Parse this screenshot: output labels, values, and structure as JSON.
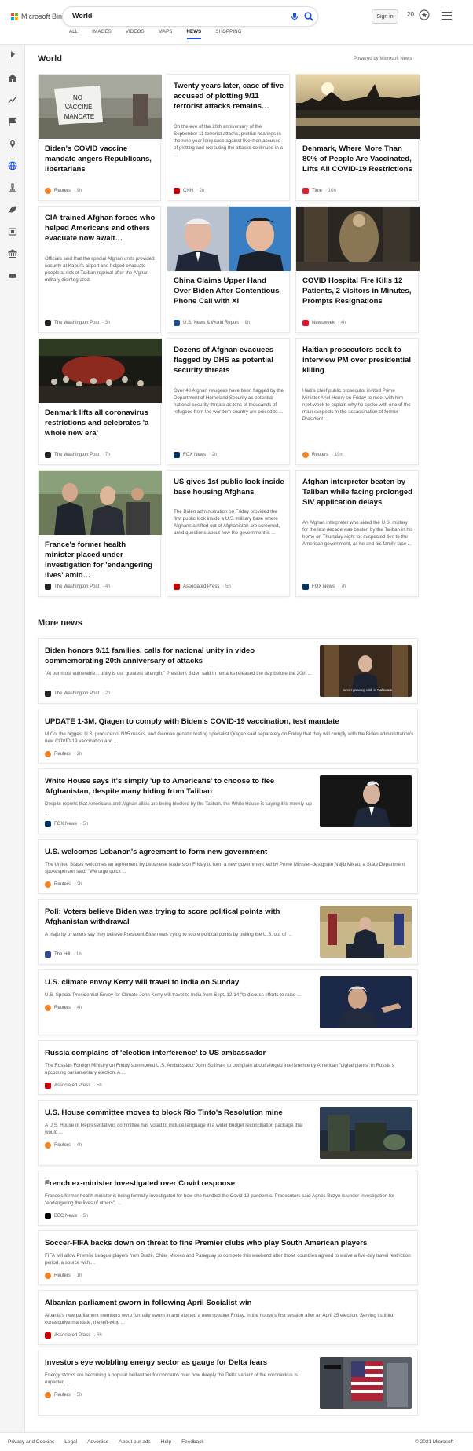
{
  "brand": {
    "name": "Microsoft Bing",
    "colors": [
      "#f25022",
      "#7fba00",
      "#00a4ef",
      "#ffb900"
    ]
  },
  "search": {
    "query": "World"
  },
  "header": {
    "signin_label": "Sign in",
    "points": "20"
  },
  "tabs": [
    {
      "label": "ALL"
    },
    {
      "label": "IMAGES"
    },
    {
      "label": "VIDEOS"
    },
    {
      "label": "MAPS"
    },
    {
      "label": "NEWS",
      "active": true
    },
    {
      "label": "SHOPPING"
    }
  ],
  "section": {
    "title": "World",
    "powered": "Powered by Microsoft News"
  },
  "cards": [
    {
      "title": "Biden's COVID vaccine mandate angers Republicans, libertarians",
      "snippet": "",
      "source": "Reuters",
      "time": "9h",
      "image": "no-vaccine-mandate-sign"
    },
    {
      "title": "Twenty years later, case of five accused of plotting 9/11 terrorist attacks remains…",
      "snippet": "On the eve of the 20th anniversary of the September 11 terrorist attacks, pretrial hearings in the nine-year-long case against five men accused of plotting and executing the attacks continued in a ...",
      "source": "CNN",
      "time": "2h",
      "image": ""
    },
    {
      "title": "Denmark, Where More Than 80% of People Are Vaccinated, Lifts All COVID-19 Restrictions",
      "snippet": "",
      "source": "Time",
      "time": "10h",
      "image": "copenhagen-sunset"
    },
    {
      "title": "CIA-trained Afghan forces who helped Americans and others evacuate now await…",
      "snippet": "Officials said that the special Afghan units provided security at Kabul's airport and helped evacuate people at risk of Taliban reprisal after the Afghan military disintegrated.",
      "source": "The Washington Post",
      "time": "3h",
      "image": ""
    },
    {
      "title": "China Claims Upper Hand Over Biden After Contentious Phone Call with Xi",
      "snippet": "",
      "source": "U.S. News & World Report",
      "time": "8h",
      "image": "biden-xi"
    },
    {
      "title": "COVID Hospital Fire Kills 12 Patients, 2 Visitors in Minutes, Prompts Resignations",
      "snippet": "",
      "source": "Newsweek",
      "time": "4h",
      "image": "hospital-fire"
    },
    {
      "title": "Denmark lifts all coronavirus restrictions and celebrates 'a whole new era'",
      "snippet": "",
      "source": "The Washington Post",
      "time": "7h",
      "image": "night-crowd"
    },
    {
      "title": "Dozens of Afghan evacuees flagged by DHS as potential security threats",
      "snippet": "Over 40 Afghan refugees have been flagged by the Department of Homeland Security as potential national security threats as tens of thousands of refugees from the war-torn country are poised to ...",
      "source": "FOX News",
      "time": "2h",
      "image": ""
    },
    {
      "title": "Haitian prosecutors seek to interview PM over presidential killing",
      "snippet": "Haiti's chief public prosecutor invited Prime Minister Ariel Henry on Friday to meet with him next week to explain why he spoke with one of the main suspects in the assassination of former President ...",
      "source": "Reuters",
      "time": "19m",
      "image": ""
    },
    {
      "title": "France's former health minister placed under investigation for 'endangering lives' amid…",
      "snippet": "",
      "source": "The Washington Post",
      "time": "4h",
      "image": "france-minister"
    },
    {
      "title": "US gives 1st public look inside base housing Afghans",
      "snippet": "The Biden administration on Friday provided the first public look inside a U.S. military base where Afghans airlifted out of Afghanistan are screened, amid questions about how the government is ...",
      "source": "Associated Press",
      "time": "5h",
      "image": ""
    },
    {
      "title": "Afghan interpreter beaten by Taliban while facing prolonged SIV application delays",
      "snippet": "An Afghan interpreter who aided the U.S. military for the last decade was beaten by the Taliban in his home on Thursday night for suspected ties to the American government, as he and his family face ...",
      "source": "FOX News",
      "time": "7h",
      "image": ""
    }
  ],
  "more_title": "More news",
  "more_news": [
    {
      "title": "Biden honors 9/11 families, calls for national unity in video commemorating 20th anniversary of attacks",
      "snippet": "\"At our most vulnerable... unity is our greatest strength,\" President Biden said in remarks released the day before the 20th ...",
      "source": "The Washington Post",
      "time": "2h",
      "image": "biden-video",
      "caption": "who I grew up with in Delaware."
    },
    {
      "title": "UPDATE 1-3M, Qiagen to comply with Biden's COVID-19 vaccination, test mandate",
      "snippet": "M Co, the biggest U.S. producer of N95 masks, and German genetic testing specialist Qiagen said separately on Friday that they will comply with the Biden administration's new COVID-19 vaccination and ...",
      "source": "Reuters",
      "time": "2h",
      "image": ""
    },
    {
      "title": "White House says it's simply 'up to Americans' to choose to flee Afghanistan, despite many hiding from Taliban",
      "snippet": "Despite reports that Americans and Afghan allies are being blocked by the Taliban, the White House is saying it is merely 'up ...",
      "source": "FOX News",
      "time": "5h",
      "image": "biden-dark"
    },
    {
      "title": "U.S. welcomes Lebanon's agreement to form new government",
      "snippet": "The United States welcomes an agreement by Lebanese leaders on Friday to form a new government led by Prime Minister-designate Najib Mikati, a State Department spokesperson said. \"We urge quick ...",
      "source": "Reuters",
      "time": "2h",
      "image": ""
    },
    {
      "title": "Poll: Voters believe Biden was trying to score political points with Afghanistan withdrawal",
      "snippet": "A majority of voters say they believe President Biden was trying to score political points by pulling the U.S. out of ...",
      "source": "The Hill",
      "time": "1h",
      "image": "biden-podium"
    },
    {
      "title": "U.S. climate envoy Kerry will travel to India on Sunday",
      "snippet": "U.S. Special Presidential Envoy for Climate John Kerry will travel to India from Sept. 12-14 \"to discuss efforts to raise ...",
      "source": "Reuters",
      "time": "4h",
      "image": "kerry"
    },
    {
      "title": "Russia complains of 'election interference' to US ambassador",
      "snippet": "The Russian Foreign Ministry on Friday summoned U.S. Ambassador John Sullivan, to complain about alleged interference by American \"digital giants\" in Russia's upcoming parliamentary election. A ...",
      "source": "Associated Press",
      "time": "5h",
      "image": ""
    },
    {
      "title": "U.S. House committee moves to block Rio Tinto's Resolution mine",
      "snippet": "A U.S. House of Representatives committee has voted to include language in a wider budget reconciliation package that would ...",
      "source": "Reuters",
      "time": "4h",
      "image": "mine"
    },
    {
      "title": "French ex-minister investigated over Covid response",
      "snippet": "France's former health minister is being formally investigated for how she handled the Covid-19 pandemic. Prosecutors said Agnès Buzyn is under investigation for \"endangering the lives of others\", ...",
      "source": "BBC News",
      "time": "5h",
      "image": ""
    },
    {
      "title": "Soccer-FIFA backs down on threat to fine Premier clubs who play South American players",
      "snippet": "FIFA will allow Premier League players from Brazil, Chile, Mexico and Paraguay to compete this weekend after those countries agreed to waive a five-day travel restriction period, a source with ...",
      "source": "Reuters",
      "time": "1h",
      "image": ""
    },
    {
      "title": "Albanian parliament sworn in following April Socialist win",
      "snippet": "Albania's new parliament members were formally sworn in and elected a new speaker Friday, in the house's first session after an April 25 election. Serving its third consecutive mandate, the left-wing ...",
      "source": "Associated Press",
      "time": "6h",
      "image": ""
    },
    {
      "title": "Investors eye wobbling energy sector as gauge for Delta fears",
      "snippet": "Energy stocks are becoming a popular bellwether for concerns over how deeply the Delta variant of the coronavirus is expected ...",
      "source": "Reuters",
      "time": "5h",
      "image": "wall-street"
    }
  ],
  "footer": {
    "links": [
      "Privacy and Cookies",
      "Legal",
      "Advertise",
      "About our ads",
      "Help",
      "Feedback"
    ],
    "copyright": "© 2021 Microsoft"
  },
  "source_colors": {
    "Reuters": "#f58220",
    "CNN": "#cc0000",
    "Time": "#e4202e",
    "The Washington Post": "#222222",
    "U.S. News & World Report": "#1d4f91",
    "Newsweek": "#e8112d",
    "FOX News": "#003366",
    "Associated Press": "#cc0000",
    "The Hill": "#2c4a9a",
    "BBC News": "#000000"
  },
  "sign_text": "NO VACCINE MANDATE"
}
